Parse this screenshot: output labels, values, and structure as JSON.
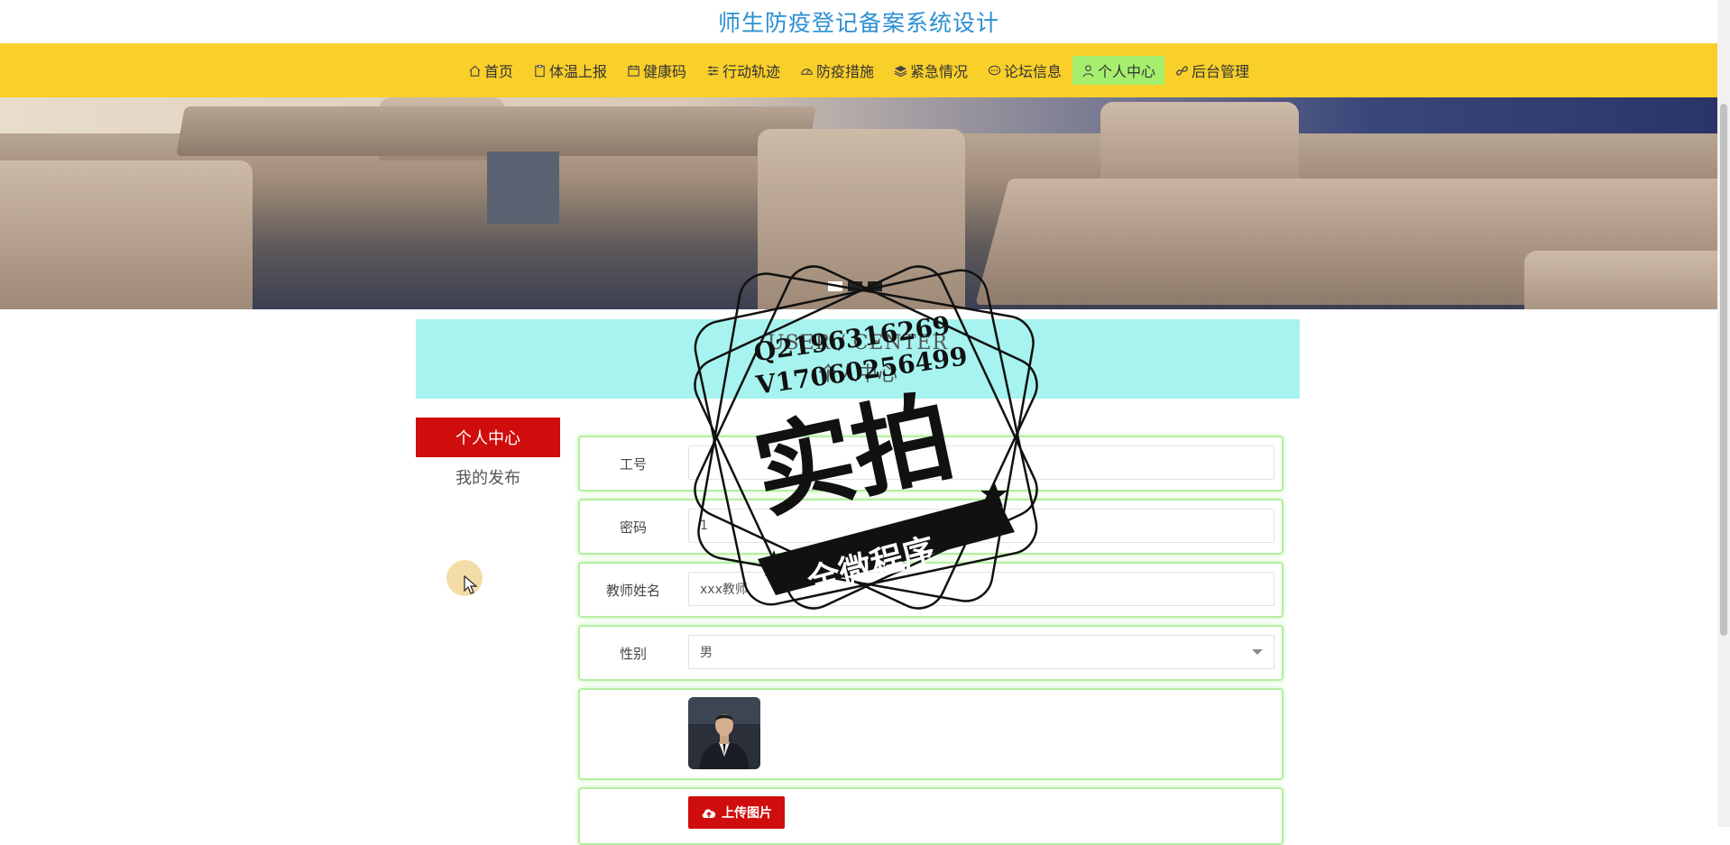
{
  "site": {
    "title": "师生防疫登记备案系统设计"
  },
  "nav": {
    "items": [
      {
        "label": "首页",
        "icon": "home-icon"
      },
      {
        "label": "体温上报",
        "icon": "clipboard-icon"
      },
      {
        "label": "健康码",
        "icon": "calendar-icon"
      },
      {
        "label": "行动轨迹",
        "icon": "sliders-icon"
      },
      {
        "label": "防疫措施",
        "icon": "gauge-icon"
      },
      {
        "label": "紧急情况",
        "icon": "layers-icon"
      },
      {
        "label": "论坛信息",
        "icon": "chat-icon"
      },
      {
        "label": "个人中心",
        "icon": "user-icon",
        "active": true
      },
      {
        "label": "后台管理",
        "icon": "link-icon"
      }
    ]
  },
  "banner": {
    "slides": 3,
    "active_index": 0
  },
  "user_center": {
    "en_title": "USER / CENTER",
    "cn_title": "个人中心"
  },
  "sidebar": {
    "items": [
      {
        "label": "个人中心",
        "active": true
      },
      {
        "label": "我的发布",
        "active": false
      }
    ]
  },
  "form": {
    "gonghao": {
      "label": "工号",
      "value": ""
    },
    "mima": {
      "label": "密码",
      "value": "1"
    },
    "xingming": {
      "label": "教师姓名",
      "value": "xxx教师"
    },
    "xingbie": {
      "label": "性别",
      "value": "男"
    },
    "photo": {
      "label": ""
    },
    "upload": {
      "label": "上传图片"
    }
  },
  "watermark": {
    "line1": "Q2196316269",
    "line2": "V17060256499",
    "main": "实拍",
    "ribbon": "全微程序"
  },
  "colors": {
    "nav_bg": "#f9cf2a",
    "nav_active": "#a6ef6e",
    "title": "#2b8fd1",
    "band": "#a6f3ef",
    "accent_red": "#d00d0d",
    "form_border": "#b3ef9f"
  }
}
